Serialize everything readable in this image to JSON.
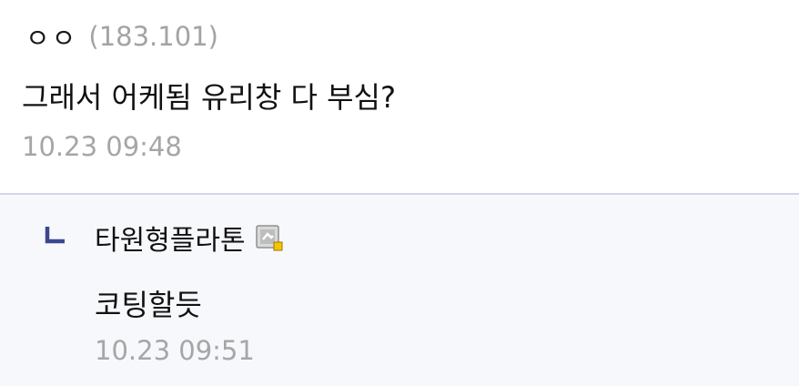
{
  "comment": {
    "nickname": "ㅇㅇ",
    "ip": "(183.101)",
    "text": "그래서 어케됨 유리창 다 부심?",
    "time": "10.23 09:48"
  },
  "reply": {
    "nickname": "타원형플라톤",
    "badge_icon": "fixed-nick-gallery-icon",
    "text": "코팅할듯",
    "time": "10.23 09:51"
  },
  "colors": {
    "reply_background": "#f7f8fb",
    "divider": "#d3d6ea",
    "reply_arrow": "#3b4890",
    "badge_dot": "#f5c400"
  }
}
